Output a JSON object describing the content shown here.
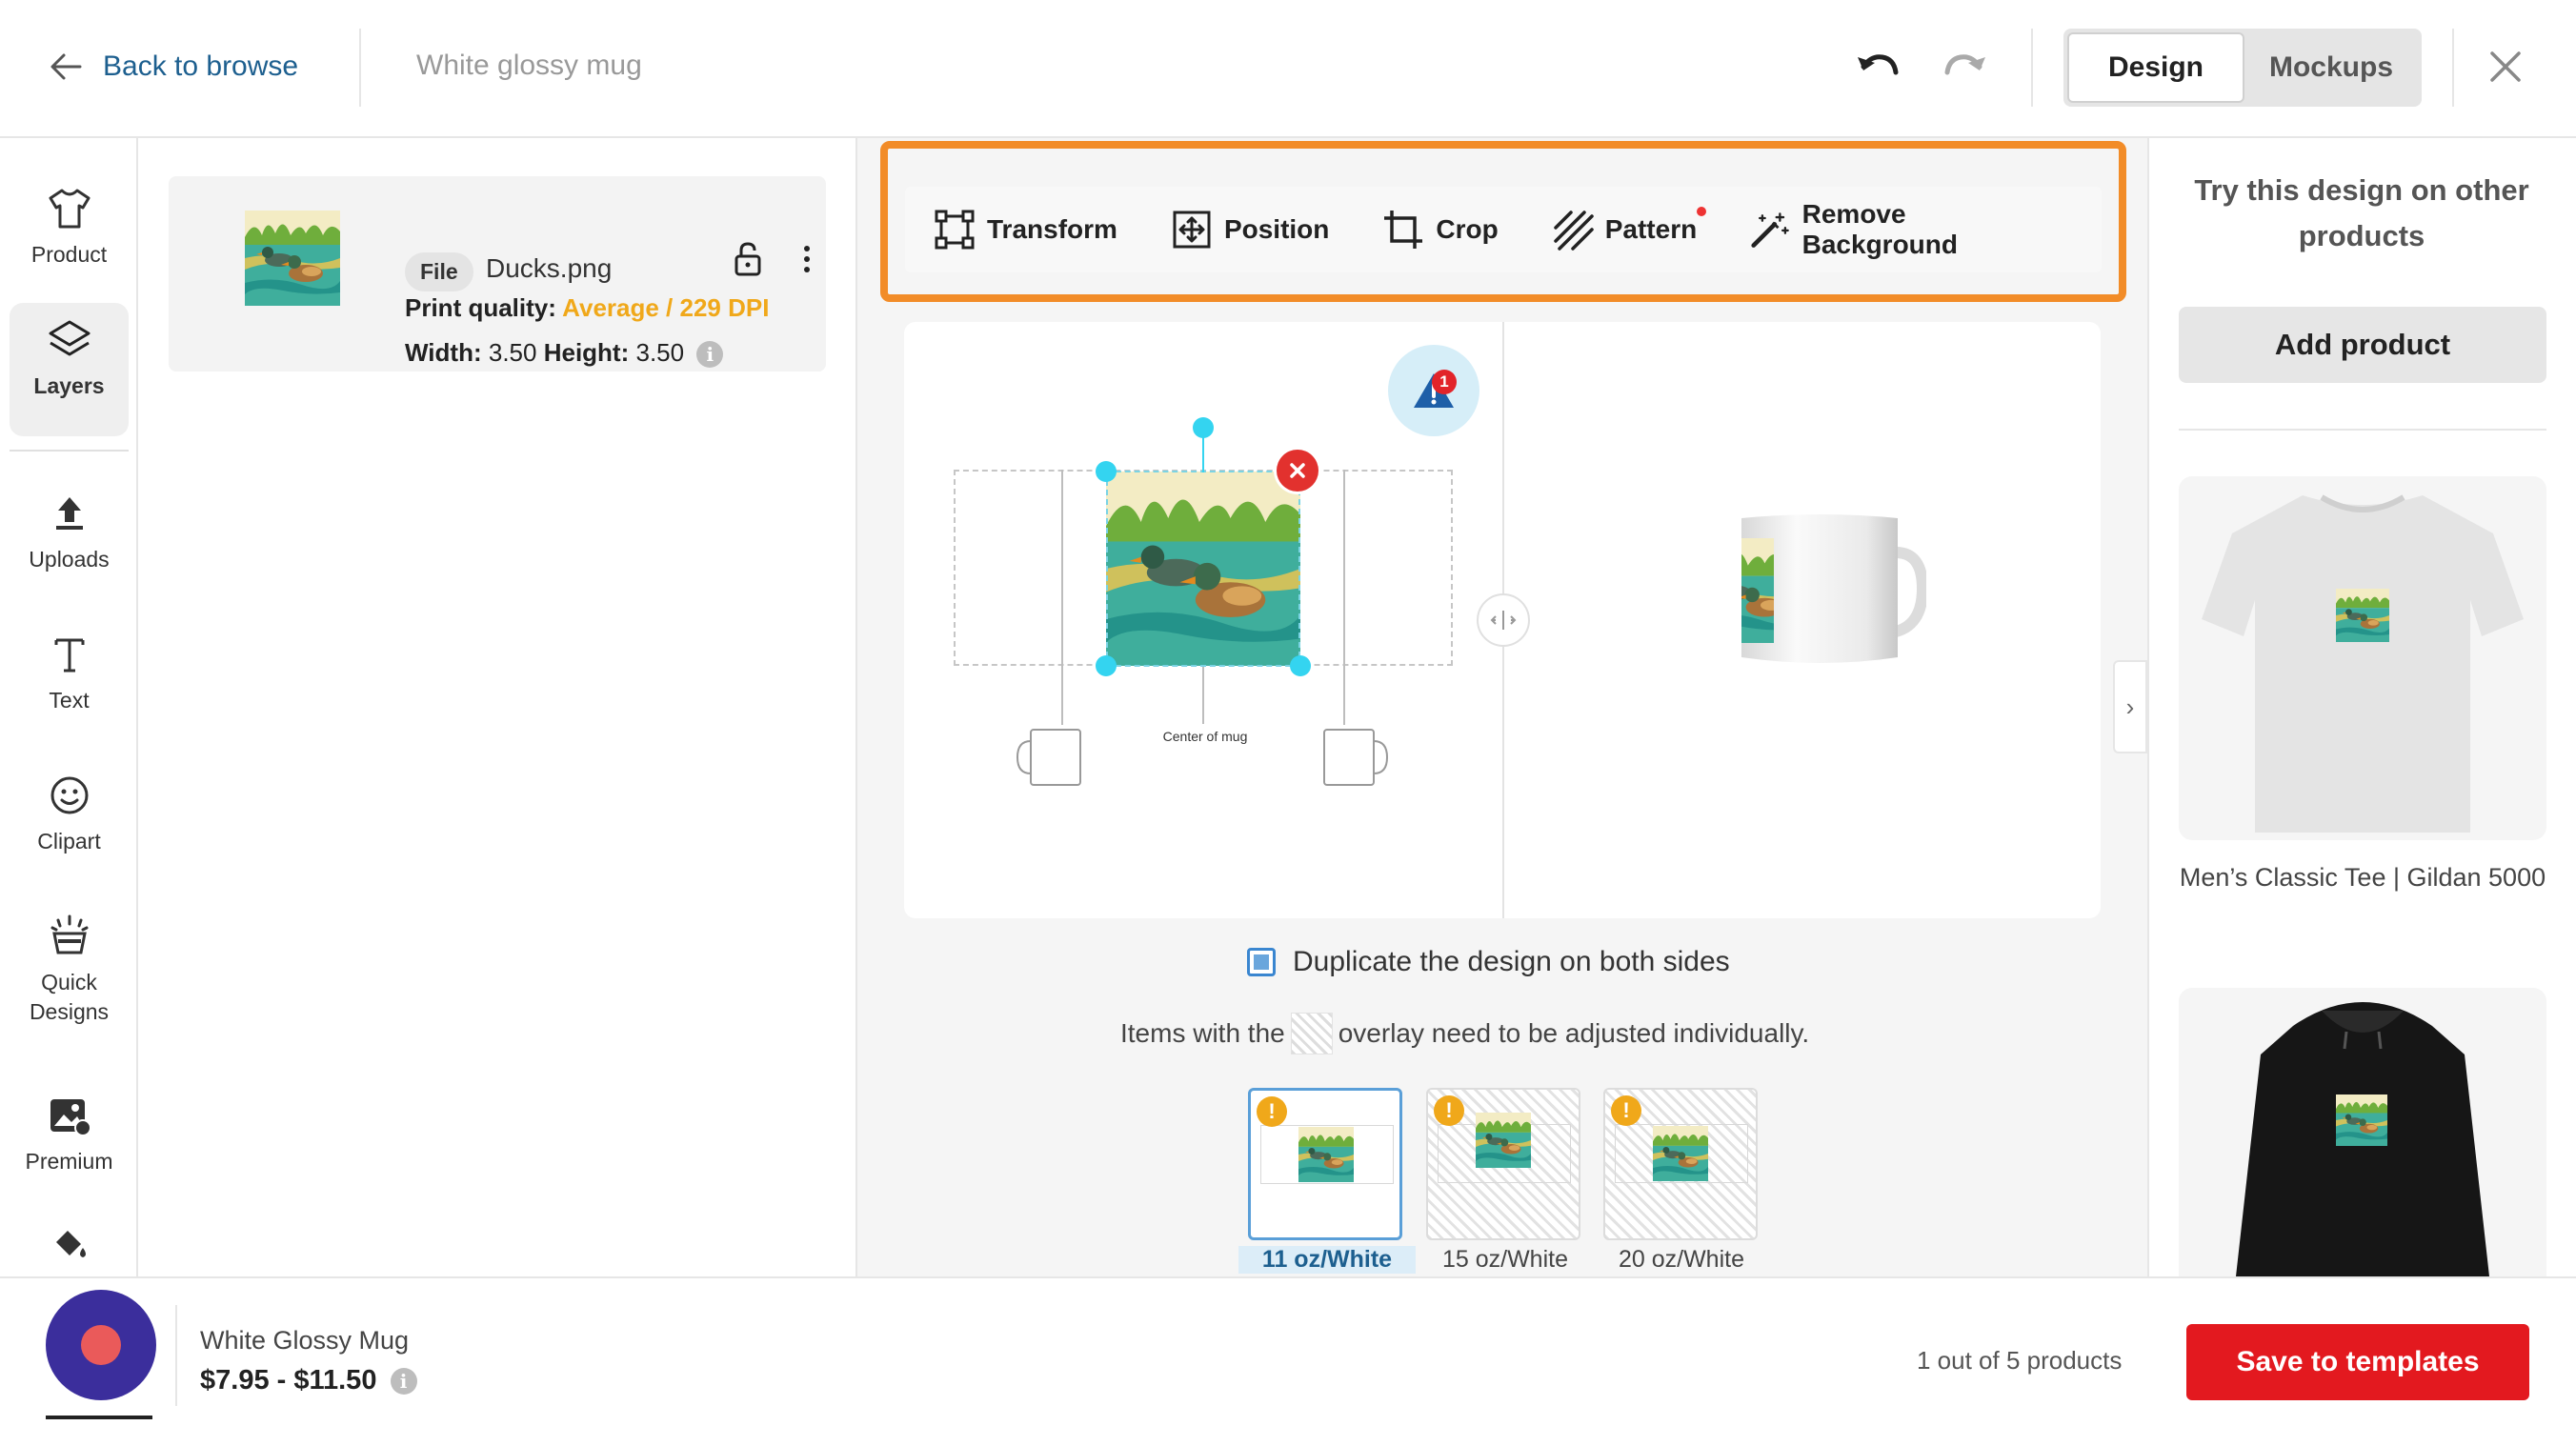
{
  "header": {
    "back_label": "Back to browse",
    "doc_title": "White glossy mug",
    "tabs": [
      {
        "label": "Design",
        "active": true
      },
      {
        "label": "Mockups",
        "active": false
      }
    ]
  },
  "sidebar": {
    "items": [
      {
        "label": "Product",
        "icon": "shirt-icon"
      },
      {
        "label": "Layers",
        "icon": "layers-icon",
        "active": true
      },
      {
        "label": "Uploads",
        "icon": "upload-icon"
      },
      {
        "label": "Text",
        "icon": "text-icon"
      },
      {
        "label": "Clipart",
        "icon": "smiley-icon"
      },
      {
        "label": "Quick\nDesigns",
        "icon": "sparkle-stack-icon"
      },
      {
        "label": "Premium",
        "icon": "premium-image-icon"
      },
      {
        "label": "",
        "icon": "paint-bucket-icon"
      }
    ]
  },
  "layer": {
    "badge": "File",
    "file_name": "Ducks.png",
    "quality_label": "Print quality:",
    "quality_value": "Average / 229 DPI",
    "width_label": "Width:",
    "width_value": "3.50",
    "height_label": "Height:",
    "height_value": "3.50"
  },
  "toolbar": {
    "tools": [
      {
        "label": "Transform",
        "icon": "transform-icon"
      },
      {
        "label": "Position",
        "icon": "position-icon"
      },
      {
        "label": "Crop",
        "icon": "crop-icon"
      },
      {
        "label": "Pattern",
        "icon": "pattern-icon",
        "dot": true
      },
      {
        "label": "Remove Background",
        "icon": "magic-wand-icon"
      }
    ]
  },
  "canvas": {
    "warning_count": "1",
    "center_label": "Center of mug"
  },
  "duplicate": {
    "label": "Duplicate the design on both sides",
    "checked": true
  },
  "overlay_note": {
    "before": "Items with the",
    "after": "overlay need to be adjusted individually."
  },
  "variants": [
    {
      "label": "11 oz/White",
      "active": true
    },
    {
      "label": "15 oz/White",
      "active": false
    },
    {
      "label": "20 oz/White",
      "active": false
    }
  ],
  "right_panel": {
    "title": "Try this design on other products",
    "add_button": "Add product",
    "products": [
      {
        "name": "Men’s Classic Tee | Gildan 5000"
      },
      {
        "name": ""
      }
    ]
  },
  "footer": {
    "product_name": "White Glossy Mug",
    "price": "$7.95 - $11.50",
    "count": "1 out of 5 products",
    "save_button": "Save to templates"
  },
  "colors": {
    "accent_orange": "#f28c28",
    "save_red": "#e3191f",
    "link_blue": "#1d5f8f",
    "quality_amber": "#f0a81a",
    "handle_cyan": "#34d4f0"
  }
}
